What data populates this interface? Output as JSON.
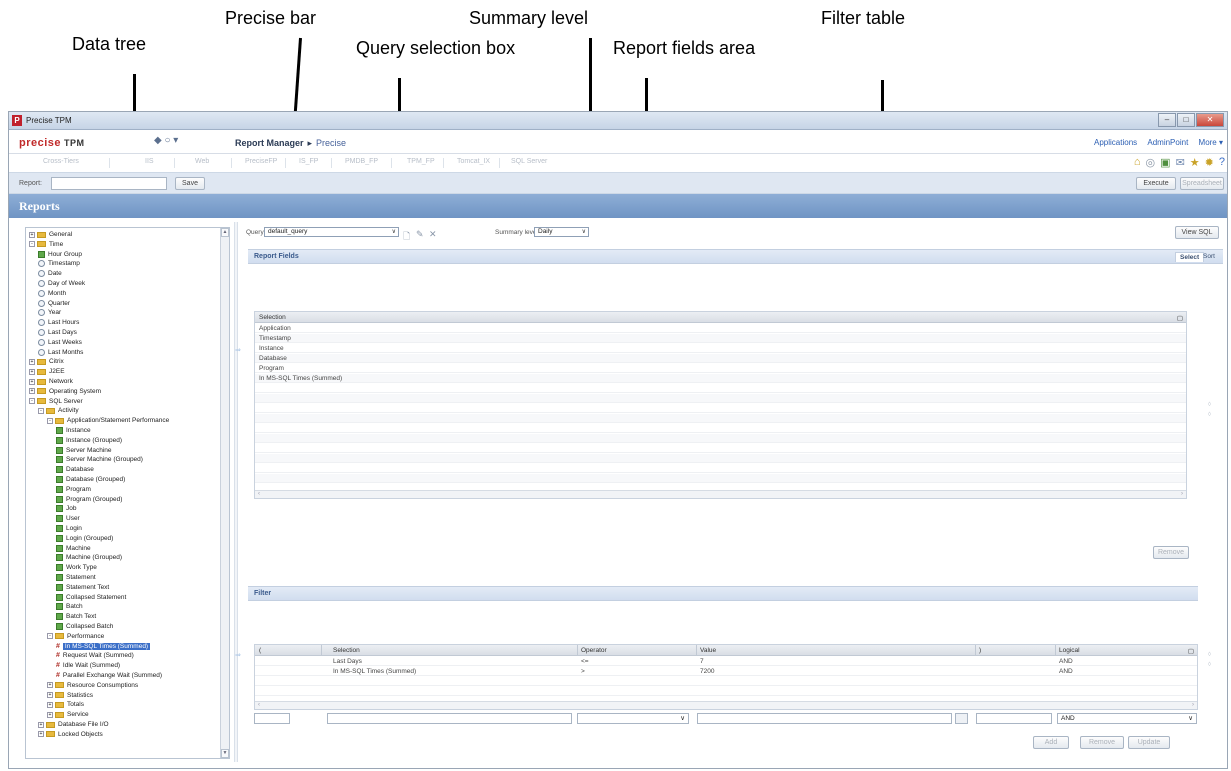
{
  "callouts": {
    "data_tree": "Data tree",
    "precise_bar": "Precise bar",
    "query_selection_box": "Query selection box",
    "summary_level": "Summary level",
    "report_fields_area": "Report fields area",
    "filter_table": "Filter table"
  },
  "window": {
    "title": "Precise TPM",
    "app_icon": "P",
    "controls": {
      "minimize": "–",
      "maximize": "□",
      "close": "✕"
    }
  },
  "header": {
    "logo": "precise",
    "logo_suffix": "TPM",
    "nav_arrows": "◆ ○ ▾",
    "breadcrumb_root": "Report Manager",
    "breadcrumb_sep": "▸",
    "breadcrumb_current": "Precise",
    "links": {
      "applications": "Applications",
      "adminpoint": "AdminPoint",
      "more": "More ▾"
    }
  },
  "tabs": [
    "Cross-Tiers",
    "IIS",
    "Web",
    "PreciseFP",
    "IS_FP",
    "PMDB_FP",
    "TPM_FP",
    "Tomcat_IX",
    "SQL Server"
  ],
  "toolbar_icons": [
    "home-icon",
    "settings-icon",
    "reports-icon",
    "mail-icon",
    "favorites-icon",
    "gear-icon",
    "help-icon"
  ],
  "report_row": {
    "label": "Report:",
    "value": "",
    "save": "Save",
    "execute": "Execute",
    "spreadsheet": "Spreadsheet"
  },
  "reports_bar": {
    "title": "Reports"
  },
  "tree": [
    {
      "label": "General",
      "level": 0,
      "icon": "folder",
      "exp": "+"
    },
    {
      "label": "Time",
      "level": 0,
      "icon": "folder",
      "exp": "-"
    },
    {
      "label": "Hour Group",
      "level": 1,
      "icon": "green"
    },
    {
      "label": "Timestamp",
      "level": 1,
      "icon": "clock"
    },
    {
      "label": "Date",
      "level": 1,
      "icon": "clock"
    },
    {
      "label": "Day of Week",
      "level": 1,
      "icon": "clock"
    },
    {
      "label": "Month",
      "level": 1,
      "icon": "clock"
    },
    {
      "label": "Quarter",
      "level": 1,
      "icon": "clock"
    },
    {
      "label": "Year",
      "level": 1,
      "icon": "clock"
    },
    {
      "label": "Last Hours",
      "level": 1,
      "icon": "clock"
    },
    {
      "label": "Last Days",
      "level": 1,
      "icon": "clock"
    },
    {
      "label": "Last Weeks",
      "level": 1,
      "icon": "clock"
    },
    {
      "label": "Last Months",
      "level": 1,
      "icon": "clock"
    },
    {
      "label": "Citrix",
      "level": 0,
      "icon": "folder",
      "exp": "+"
    },
    {
      "label": "J2EE",
      "level": 0,
      "icon": "folder",
      "exp": "+"
    },
    {
      "label": "Network",
      "level": 0,
      "icon": "folder",
      "exp": "+"
    },
    {
      "label": "Operating System",
      "level": 0,
      "icon": "folder",
      "exp": "+"
    },
    {
      "label": "SQL Server",
      "level": 0,
      "icon": "folder",
      "exp": "-"
    },
    {
      "label": "Activity",
      "level": 1,
      "icon": "folder",
      "exp": "-"
    },
    {
      "label": "Application/Statement Performance",
      "level": 2,
      "icon": "folder",
      "exp": "-"
    },
    {
      "label": "Instance",
      "level": 3,
      "icon": "green"
    },
    {
      "label": "Instance (Grouped)",
      "level": 3,
      "icon": "green"
    },
    {
      "label": "Server Machine",
      "level": 3,
      "icon": "green"
    },
    {
      "label": "Server Machine (Grouped)",
      "level": 3,
      "icon": "green"
    },
    {
      "label": "Database",
      "level": 3,
      "icon": "green"
    },
    {
      "label": "Database (Grouped)",
      "level": 3,
      "icon": "green"
    },
    {
      "label": "Program",
      "level": 3,
      "icon": "green"
    },
    {
      "label": "Program (Grouped)",
      "level": 3,
      "icon": "green"
    },
    {
      "label": "Job",
      "level": 3,
      "icon": "green"
    },
    {
      "label": "User",
      "level": 3,
      "icon": "green"
    },
    {
      "label": "Login",
      "level": 3,
      "icon": "green"
    },
    {
      "label": "Login (Grouped)",
      "level": 3,
      "icon": "green"
    },
    {
      "label": "Machine",
      "level": 3,
      "icon": "green"
    },
    {
      "label": "Machine (Grouped)",
      "level": 3,
      "icon": "green"
    },
    {
      "label": "Work Type",
      "level": 3,
      "icon": "green"
    },
    {
      "label": "Statement",
      "level": 3,
      "icon": "green"
    },
    {
      "label": "Statement Text",
      "level": 3,
      "icon": "green"
    },
    {
      "label": "Collapsed Statement",
      "level": 3,
      "icon": "green"
    },
    {
      "label": "Batch",
      "level": 3,
      "icon": "green"
    },
    {
      "label": "Batch Text",
      "level": 3,
      "icon": "green"
    },
    {
      "label": "Collapsed Batch",
      "level": 3,
      "icon": "green"
    },
    {
      "label": "Performance",
      "level": 2,
      "icon": "folder",
      "exp": "-"
    },
    {
      "label": "In MS-SQL Times (Summed)",
      "level": 3,
      "icon": "hash",
      "selected": true
    },
    {
      "label": "Request Wait (Summed)",
      "level": 3,
      "icon": "hash"
    },
    {
      "label": "Idle Wait (Summed)",
      "level": 3,
      "icon": "hash"
    },
    {
      "label": "Parallel Exchange Wait (Summed)",
      "level": 3,
      "icon": "hash"
    },
    {
      "label": "Resource Consumptions",
      "level": 2,
      "icon": "folder",
      "exp": "+"
    },
    {
      "label": "Statistics",
      "level": 2,
      "icon": "folder",
      "exp": "+"
    },
    {
      "label": "Totals",
      "level": 2,
      "icon": "folder",
      "exp": "+"
    },
    {
      "label": "Service",
      "level": 2,
      "icon": "folder",
      "exp": "+"
    },
    {
      "label": "Database File I/O",
      "level": 1,
      "icon": "folder",
      "exp": "+"
    },
    {
      "label": "Locked Objects",
      "level": 1,
      "icon": "folder",
      "exp": "+"
    }
  ],
  "query": {
    "label": "Query:",
    "value": "default_query",
    "summary_label": "Summary level:",
    "summary_value": "Daily",
    "view_sql": "View SQL"
  },
  "report_fields": {
    "title": "Report Fields",
    "tab_select": "Select",
    "tab_sort": "Sort",
    "column": "Selection",
    "rows": [
      "Application",
      "Timestamp",
      "Instance",
      "Database",
      "Program",
      "In MS-SQL Times (Summed)"
    ],
    "remove": "Remove"
  },
  "filter": {
    "title": "Filter",
    "columns": [
      "(",
      "Selection",
      "Operator",
      "Value",
      ")",
      "Logical"
    ],
    "rows": [
      {
        "paren_open": "",
        "selection": "Last Days",
        "operator": "<=",
        "value": "7",
        "paren_close": "",
        "logical": "AND"
      },
      {
        "paren_open": "",
        "selection": "In MS-SQL Times (Summed)",
        "operator": ">",
        "value": "7200",
        "paren_close": "",
        "logical": "AND"
      }
    ],
    "new_logical": "AND",
    "add": "Add",
    "remove": "Remove",
    "update": "Update"
  }
}
